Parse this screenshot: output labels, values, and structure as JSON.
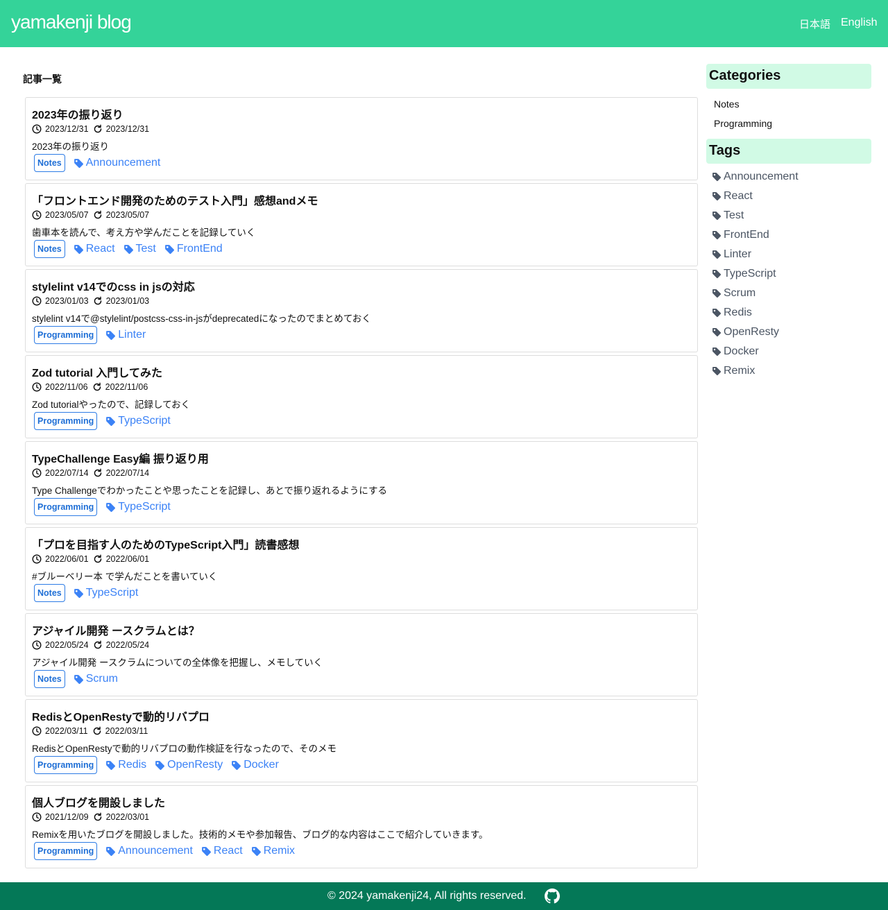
{
  "header": {
    "brand": "yamakenji blog",
    "lang_ja": "日本語",
    "lang_en": "English"
  },
  "main": {
    "list_title": "記事一覧",
    "posts": [
      {
        "title": "2023年の振り返り",
        "created": "2023/12/31",
        "updated": "2023/12/31",
        "description": "2023年の振り返り",
        "category": "Notes",
        "tags": [
          "Announcement"
        ]
      },
      {
        "title": "「フロントエンド開発のためのテスト入門」感想andメモ",
        "created": "2023/05/07",
        "updated": "2023/05/07",
        "description": "歯車本を読んで、考え方や学んだことを記録していく",
        "category": "Notes",
        "tags": [
          "React",
          "Test",
          "FrontEnd"
        ]
      },
      {
        "title": "stylelint v14でのcss in jsの対応",
        "created": "2023/01/03",
        "updated": "2023/01/03",
        "description": "stylelint v14で@stylelint/postcss-css-in-jsがdeprecatedになったのでまとめておく",
        "category": "Programming",
        "tags": [
          "Linter"
        ]
      },
      {
        "title": "Zod tutorial 入門してみた",
        "created": "2022/11/06",
        "updated": "2022/11/06",
        "description": "Zod tutorialやったので、記録しておく",
        "category": "Programming",
        "tags": [
          "TypeScript"
        ]
      },
      {
        "title": "TypeChallenge Easy編 振り返り用",
        "created": "2022/07/14",
        "updated": "2022/07/14",
        "description": "Type Challengeでわかったことや思ったことを記録し、あとで振り返れるようにする",
        "category": "Programming",
        "tags": [
          "TypeScript"
        ]
      },
      {
        "title": "「プロを目指す人のためのTypeScript入門」読書感想",
        "created": "2022/06/01",
        "updated": "2022/06/01",
        "description": "#ブルーベリー本 で学んだことを書いていく",
        "category": "Notes",
        "tags": [
          "TypeScript"
        ]
      },
      {
        "title": "アジャイル開発 ースクラムとは？",
        "created": "2022/05/24",
        "updated": "2022/05/24",
        "description": "アジャイル開発 ースクラムについての全体像を把握し、メモしていく",
        "category": "Notes",
        "tags": [
          "Scrum"
        ]
      },
      {
        "title": "RedisとOpenRestyで動的リバプロ",
        "created": "2022/03/11",
        "updated": "2022/03/11",
        "description": "RedisとOpenRestyで動的リバプロの動作検証を行なったので、そのメモ",
        "category": "Programming",
        "tags": [
          "Redis",
          "OpenResty",
          "Docker"
        ]
      },
      {
        "title": "個人ブログを開設しました",
        "created": "2021/12/09",
        "updated": "2022/03/01",
        "description": "Remixを用いたブログを開設しました。技術的メモや参加報告、ブログ的な内容はここで紹介していきます。",
        "category": "Programming",
        "tags": [
          "Announcement",
          "React",
          "Remix"
        ]
      }
    ]
  },
  "sidebar": {
    "categories_title": "Categories",
    "categories": [
      "Notes",
      "Programming"
    ],
    "tags_title": "Tags",
    "tags": [
      "Announcement",
      "React",
      "Test",
      "FrontEnd",
      "Linter",
      "TypeScript",
      "Scrum",
      "Redis",
      "OpenResty",
      "Docker",
      "Remix"
    ]
  },
  "footer": {
    "copyright": "© 2024 yamakenji24, All rights reserved."
  },
  "icons": {
    "created": "clock-icon",
    "updated": "refresh-icon",
    "tag": "tag-icon",
    "footer": "github-icon"
  },
  "colors": {
    "header": "#34d399",
    "footer": "#047857",
    "sidebar_head": "#d1fae5",
    "link": "#3b82f6",
    "badge": "#2c7be5"
  }
}
